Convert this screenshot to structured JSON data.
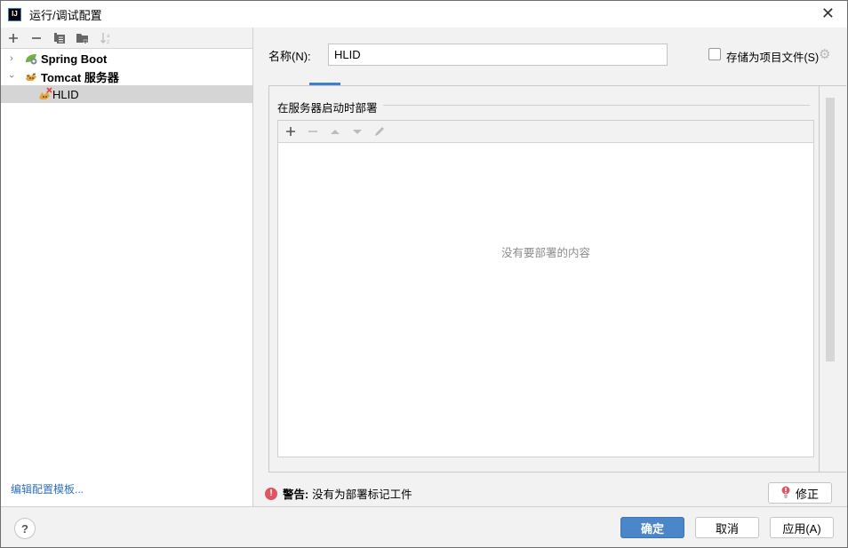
{
  "window": {
    "title": "运行/调试配置",
    "app_icon": "IJ"
  },
  "left_panel": {
    "toolbar": [
      {
        "icon": "plus-icon",
        "glyph": "+",
        "enabled": true
      },
      {
        "icon": "minus-icon",
        "glyph": "−",
        "enabled": true
      },
      {
        "icon": "copy-icon",
        "glyph": "⧉",
        "enabled": true
      },
      {
        "icon": "new-folder-icon",
        "glyph": "▆",
        "enabled": true
      },
      {
        "icon": "sort-alpha-icon",
        "glyph": "↓ᵃ",
        "enabled": false
      }
    ],
    "tree": [
      {
        "label": "Spring Boot",
        "expanded": false,
        "icon": "spring-boot-icon",
        "level": 0
      },
      {
        "label": "Tomcat 服务器",
        "expanded": true,
        "icon": "tomcat-icon",
        "level": 0
      },
      {
        "label": "HLID",
        "icon": "tomcat-error-icon",
        "level": 1,
        "selected": true
      }
    ],
    "edit_templates_link": "编辑配置模板..."
  },
  "right_panel": {
    "name_label": "名称(N):",
    "name_value": "HLID",
    "store_as_project_file": {
      "label": "存储为项目文件(S)",
      "checked": false
    },
    "deploy_section": {
      "title": "在服务器启动时部署",
      "empty_text": "没有要部署的内容"
    },
    "warning": {
      "prefix": "警告:",
      "message": "没有为部署标记工件"
    },
    "fix_button": "修正"
  },
  "bottom": {
    "help": "?",
    "ok": "确定",
    "cancel": "取消",
    "apply": "应用(A)"
  },
  "colors": {
    "accent": "#4a86c8",
    "link": "#2f6fc2",
    "error": "#db5860"
  }
}
